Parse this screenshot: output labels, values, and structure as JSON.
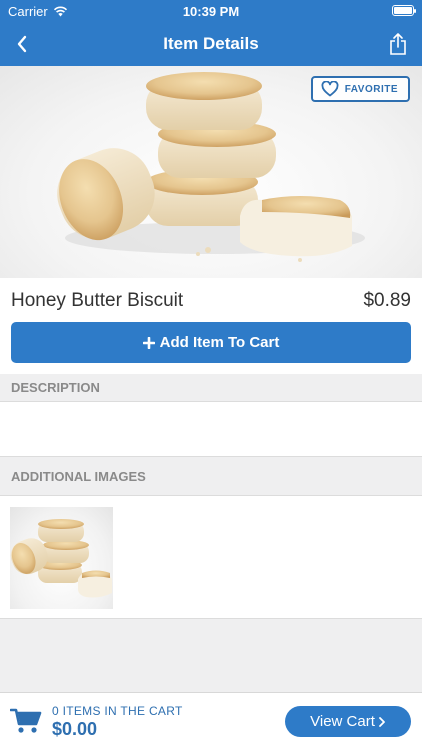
{
  "status_bar": {
    "carrier": "Carrier",
    "time": "10:39 PM"
  },
  "nav": {
    "title": "Item Details",
    "back_icon": "chevron-left-icon",
    "share_icon": "share-icon"
  },
  "hero": {
    "favorite_label": "FAVORITE",
    "favorite_icon": "heart-outline-icon"
  },
  "item": {
    "name": "Honey Butter Biscuit",
    "price": "$0.89"
  },
  "add_to_cart": {
    "label": "Add Item To Cart",
    "icon": "plus-icon"
  },
  "sections": {
    "description_header": "DESCRIPTION",
    "description_text": "",
    "additional_images_header": "ADDITIONAL IMAGES"
  },
  "cart_footer": {
    "count_text": "0 ITEMS IN THE CART",
    "total": "$0.00",
    "view_cart_label": "View Cart",
    "cart_icon": "shopping-cart-icon"
  },
  "colors": {
    "brand_blue": "#2e7bc8",
    "accent_blue": "#2e6fb0",
    "section_bg": "#efeff0",
    "section_text": "#8a8a8a"
  }
}
